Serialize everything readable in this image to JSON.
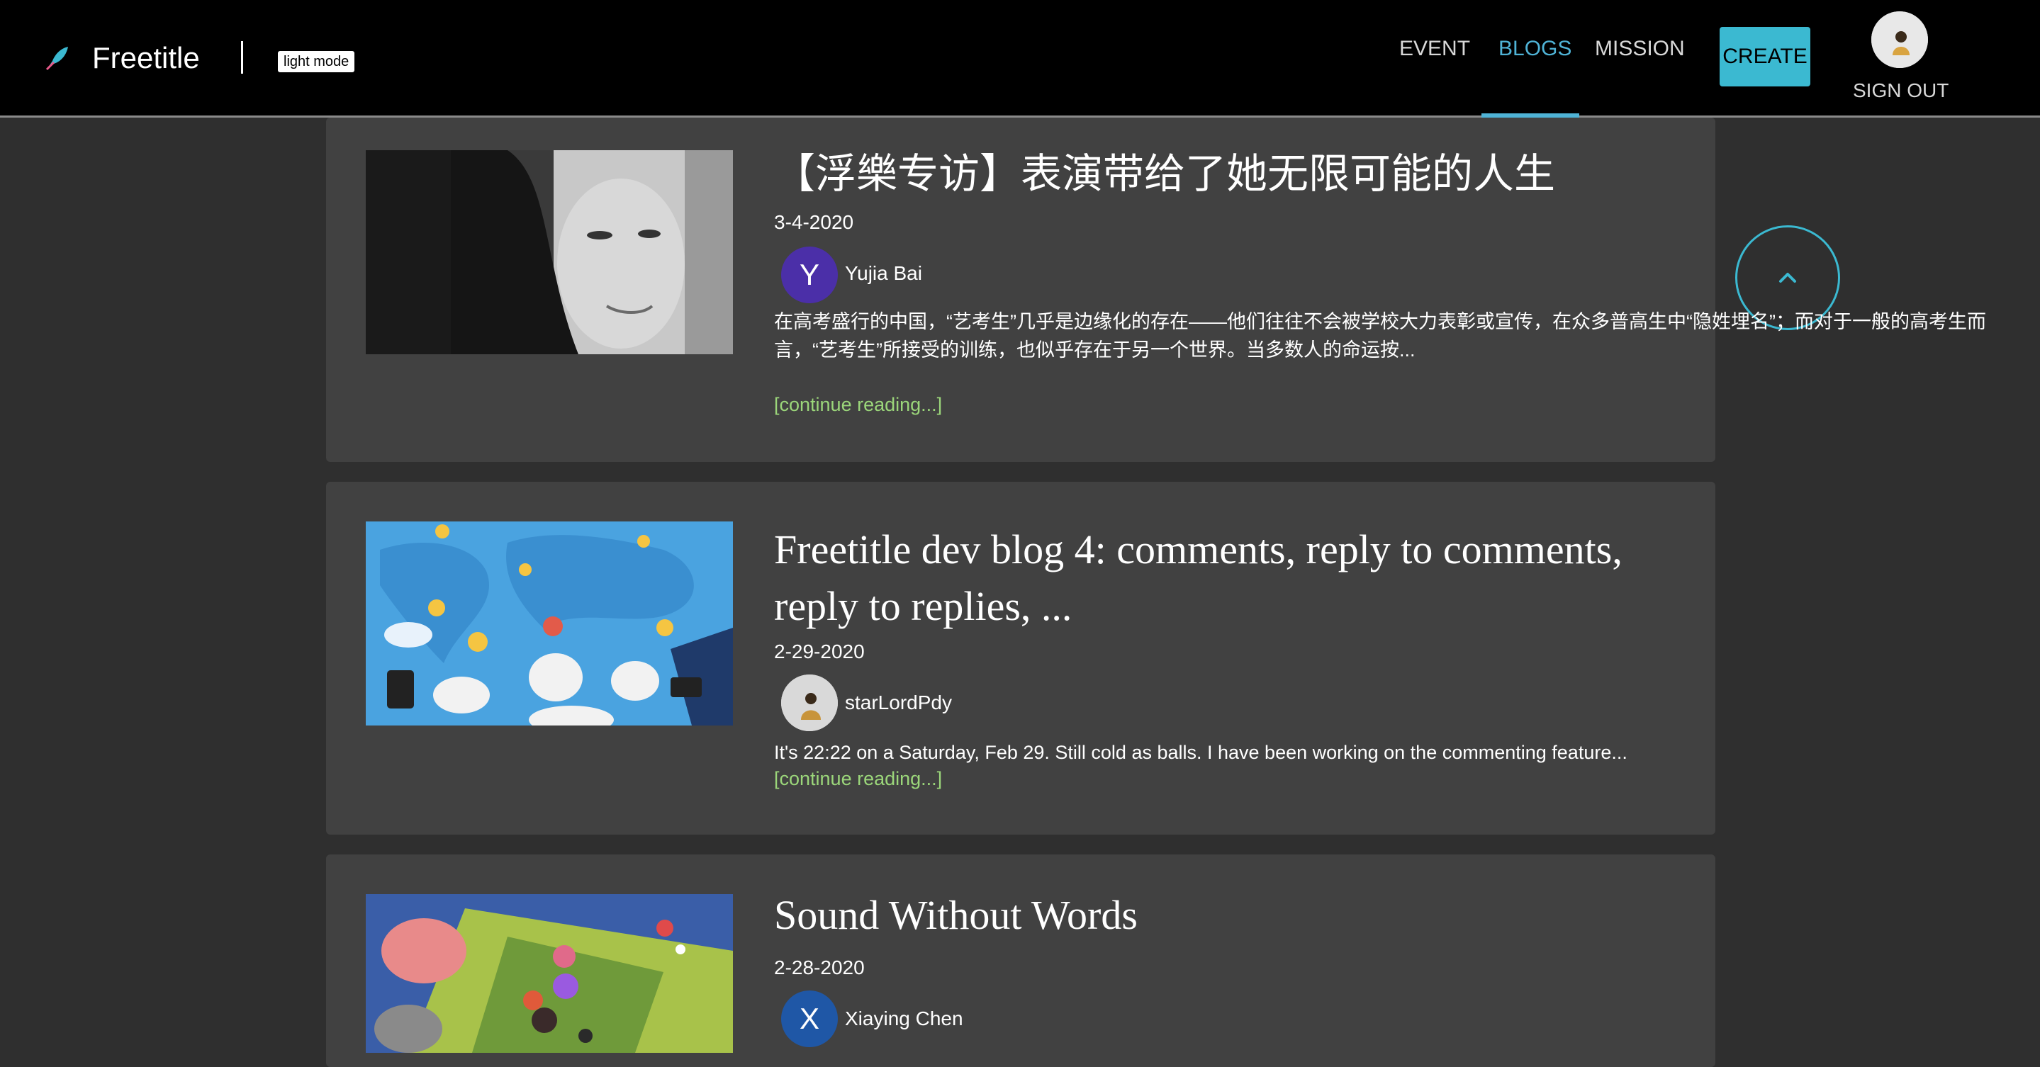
{
  "header": {
    "brand": "Freetitle",
    "mode_toggle": "light mode",
    "nav": [
      "EVENT",
      "BLOGS",
      "MISSION"
    ],
    "active_nav": "BLOGS",
    "create_label": "CREATE",
    "sign_out_label": "SIGN OUT"
  },
  "posts": [
    {
      "title": "【浮樂专访】表演带给了她无限可能的人生",
      "date": "3-4-2020",
      "author_initial": "Y",
      "author": "Yujia Bai",
      "excerpt": "在高考盛行的中国，“艺考生”几乎是边缘化的存在——他们往往不会被学校大力表彰或宣传，在众多普高生中“隐姓埋名”；而对于一般的高考生而言，“艺考生”所接受的训练，也似乎存在于另一个世界。当多数人的命运按...",
      "more": "[continue reading...]"
    },
    {
      "title": "Freetitle dev blog 4: comments, reply to comments, reply to replies, ...",
      "date": "2-29-2020",
      "author": "starLordPdy",
      "excerpt": "It's 22:22 on a Saturday, Feb 29. Still cold as balls. I have been working on the commenting feature...",
      "more": "[continue reading...]"
    },
    {
      "title": "Sound Without Words",
      "date": "2-28-2020",
      "author_initial": "X",
      "author": "Xiaying Chen"
    }
  ],
  "colors": {
    "accent": "#4fb3d6",
    "create_button": "#3bb9d1",
    "link_green": "#9bd67a",
    "avatar_purple": "#4b2fa8",
    "avatar_blue": "#1f57a6"
  }
}
